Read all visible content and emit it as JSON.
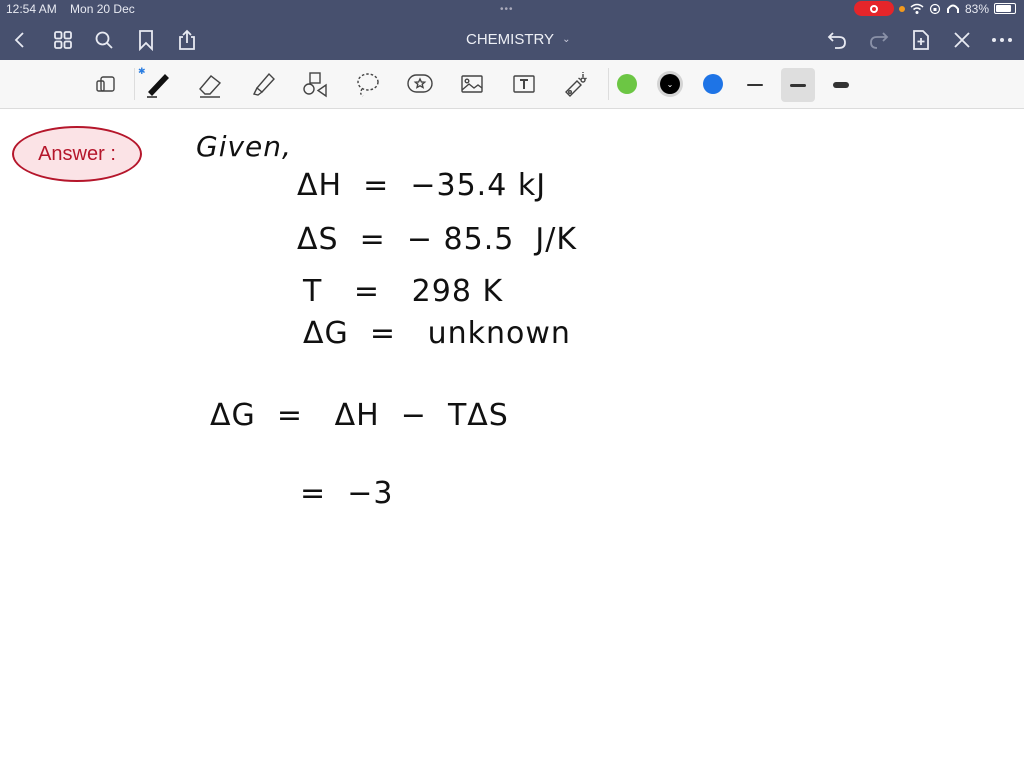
{
  "status_bar": {
    "time": "12:54 AM",
    "date": "Mon 20 Dec",
    "battery_percent": "83%",
    "battery_level": 0.83,
    "icons": [
      "screen-record-icon",
      "mic-in-use-dot",
      "wifi-icon",
      "orientation-lock-icon",
      "headphones-icon",
      "battery-icon"
    ]
  },
  "nav": {
    "title": "CHEMISTRY",
    "left_icons": [
      "back-icon",
      "grid-icon",
      "search-icon",
      "bookmark-icon",
      "share-icon"
    ],
    "right_icons": [
      "undo-icon",
      "redo-icon",
      "add-page-icon",
      "close-pen-icon",
      "more-icon"
    ]
  },
  "toolbar": {
    "tools": [
      "read-mode-icon",
      "pen-icon",
      "eraser-icon",
      "highlighter-icon",
      "shapes-icon",
      "lasso-icon",
      "sticker-icon",
      "image-icon",
      "text-icon",
      "laser-pointer-icon"
    ],
    "colors": [
      "#6cc644",
      "#000000",
      "#1e74e6"
    ],
    "selected_color": "#000000",
    "stroke_widths": [
      "thin",
      "medium",
      "thick"
    ],
    "selected_stroke": "medium"
  },
  "page": {
    "answer_label": "Answer :",
    "lines": [
      "Given,",
      "ΔH  =  −35.4 kJ",
      "ΔS  =  − 85.5  J/K",
      "T   =   298 K",
      "ΔG  =   unknown",
      "ΔG  =   ΔH  −  TΔS",
      "=  −3"
    ]
  }
}
